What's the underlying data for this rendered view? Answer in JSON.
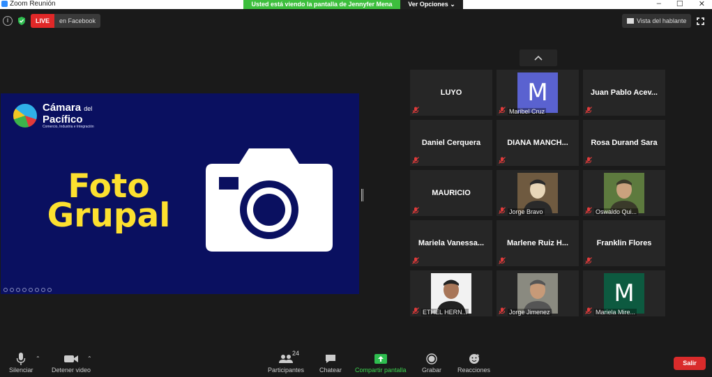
{
  "window": {
    "title": "Zoom Reunión",
    "controls": [
      "–",
      "☐",
      "✕"
    ]
  },
  "share_banner": {
    "message": "Usted está viendo la pantalla de Jennyfer Mena",
    "options": "Ver Opciones ⌄"
  },
  "topbar": {
    "info": "i",
    "live": "LIVE",
    "stream_target": "en Facebook",
    "view_label": "Vista del hablante"
  },
  "slide": {
    "brand_line1": "Cámara",
    "brand_del": "del",
    "brand_line2": "Pacífico",
    "brand_tagline": "Comercio, Industria e Integración",
    "heading_line1": "Foto",
    "heading_line2": "Grupal"
  },
  "participants": [
    {
      "display": "LUYO",
      "label": ""
    },
    {
      "display": "M",
      "label": "Maribel Cruz",
      "avatar_color": "#5a62d0"
    },
    {
      "display": "Juan  Pablo  Acev...",
      "label": ""
    },
    {
      "display": "Daniel Cerquera",
      "label": ""
    },
    {
      "display": "DIANA  MANCH...",
      "label": ""
    },
    {
      "display": "Rosa Durand Sara",
      "label": ""
    },
    {
      "display": "MAURICIO",
      "label": ""
    },
    {
      "display": "",
      "label": "Jorge Bravo"
    },
    {
      "display": "",
      "label": "Oswaldo Qui..."
    },
    {
      "display": "Mariela  Vanessa...",
      "label": ""
    },
    {
      "display": "Marlene  Ruiz  H...",
      "label": ""
    },
    {
      "display": "Franklin Flores",
      "label": ""
    },
    {
      "display": "",
      "label": "ETHEL HERN..."
    },
    {
      "display": "",
      "label": "Jorge Jimenez"
    },
    {
      "display": "M",
      "label": "Mariela Mire...",
      "avatar_color": "#0d5a40"
    }
  ],
  "toolbar": {
    "mute": "Silenciar",
    "video": "Detener video",
    "participants": "Participantes",
    "participants_count": "24",
    "chat": "Chatear",
    "share": "Compartir pantalla",
    "record": "Grabar",
    "reactions": "Reacciones",
    "leave": "Salir"
  },
  "colors": {
    "live": "#e02828",
    "share_green": "#3dbf3d",
    "leave_red": "#d92b2b",
    "slide_bg": "#0a1060",
    "heading_yellow": "#fde02f"
  }
}
